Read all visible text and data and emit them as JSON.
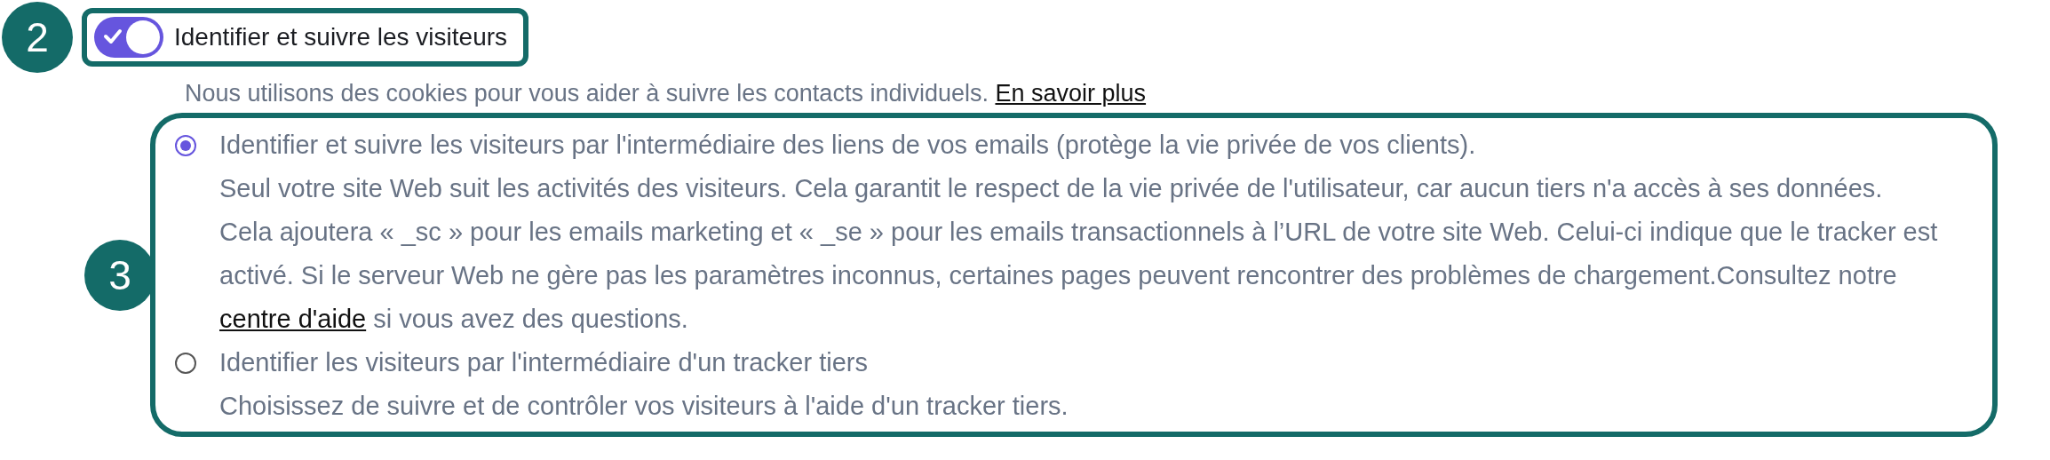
{
  "tracking_toggle": {
    "step_badge": "2",
    "label": "Identifier et suivre les visiteurs",
    "on": true,
    "description": "Nous utilisons des cookies pour vous aider à suivre les contacts individuels.",
    "link": "En savoir plus"
  },
  "tracking_options": {
    "step_badge": "3",
    "options": [
      {
        "label": "Identifier et suivre les visiteurs par l'intermédiaire des liens de vos emails (protège la vie privée de vos clients).",
        "selected": true,
        "details": [
          {
            "text": "Seul votre site Web suit les activités des visiteurs. Cela garantit le respect de la vie privée de l'utilisateur, car aucun tiers n'a accès à ses données."
          },
          {
            "text": "Cela ajoutera « _sc » pour les emails marketing et « _se » pour les emails transactionnels à l’URL de votre site Web. Celui-ci indique que le tracker est activé. Si le serveur Web ne gère pas les paramètres inconnus, certaines pages peuvent rencontrer des problèmes de chargement.Consultez notre",
            "link": "centre d'aide",
            "after": "si vous avez des questions."
          }
        ]
      },
      {
        "label": "Identifier les visiteurs par l'intermédiaire d'un tracker tiers",
        "selected": false,
        "details": [
          {
            "text": "Choisissez de suivre et de contrôler vos visiteurs à l'aide d'un tracker tiers."
          }
        ]
      }
    ]
  }
}
